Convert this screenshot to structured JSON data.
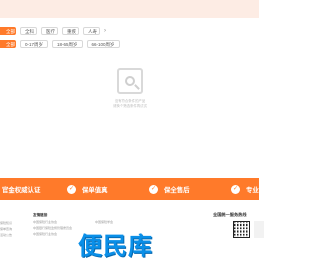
{
  "filters": {
    "row1": {
      "label": "全部",
      "options": [
        "全科",
        "医疗",
        "重疾",
        "人寿"
      ],
      "more_icon": "chevron-right-icon"
    },
    "row2": {
      "label": "全部",
      "options": [
        "0-17周岁",
        "18-65周岁",
        "66-100周岁"
      ]
    }
  },
  "empty_state": {
    "icon": "empty-search-icon",
    "line1": "没有符合条件的产品",
    "line2": "请换个筛选条件再试试"
  },
  "features": [
    {
      "icon": "shield-icon",
      "label": "官金权威认证"
    },
    {
      "icon": "shield-icon",
      "label": "保单值真"
    },
    {
      "icon": "shield-icon",
      "label": "保全售后"
    },
    {
      "icon": "shield-icon",
      "label": "专业设"
    }
  ],
  "footer": {
    "left_col": [
      "保险知识",
      "保单查询",
      "活动公告"
    ],
    "col1": {
      "title": "友情链接",
      "links": [
        "中国保险行业协会",
        "中国银行保险监督管理委员会",
        "中国保险行业协会"
      ]
    },
    "col2": {
      "links": [
        "中国保险学会"
      ]
    },
    "hotline_label": "全国统一服务热线",
    "qr_icon": "qr-code-icon"
  },
  "watermark": "便民库",
  "colors": {
    "accent": "#ff7a2a",
    "top_band": "#fdece4",
    "watermark": "#0a8fe8"
  }
}
